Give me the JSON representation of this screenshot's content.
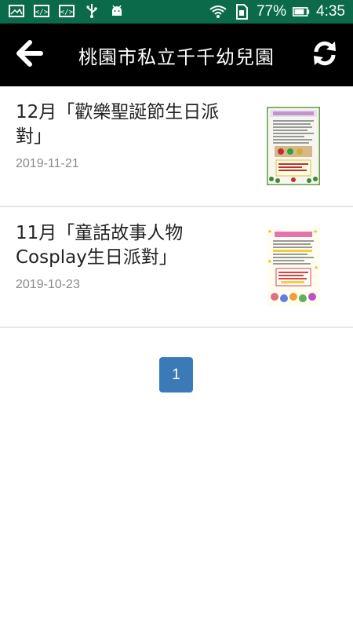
{
  "status_bar": {
    "battery_percent": "77%",
    "time": "4:35",
    "icons": [
      "gallery-icon",
      "code-icon",
      "code-icon",
      "usb-icon",
      "android-icon",
      "wifi-icon",
      "sim-icon",
      "battery-icon"
    ]
  },
  "app_bar": {
    "title": "桃園市私立千千幼兒園",
    "back_icon": "arrow-left-icon",
    "refresh_icon": "refresh-icon"
  },
  "articles": [
    {
      "title": "12月「歡樂聖誕節生日派對」",
      "date": "2019-11-21",
      "thumbnail": "christmas-flyer"
    },
    {
      "title": "11月「童話故事人物Cosplay生日派對」",
      "date": "2019-10-23",
      "thumbnail": "cosplay-flyer"
    }
  ],
  "pagination": {
    "current_page": "1"
  },
  "colors": {
    "status_bar": "#0b6a4a",
    "app_bar": "#000000",
    "pager": "#3a7ab6",
    "date_text": "#8a8a8a"
  }
}
